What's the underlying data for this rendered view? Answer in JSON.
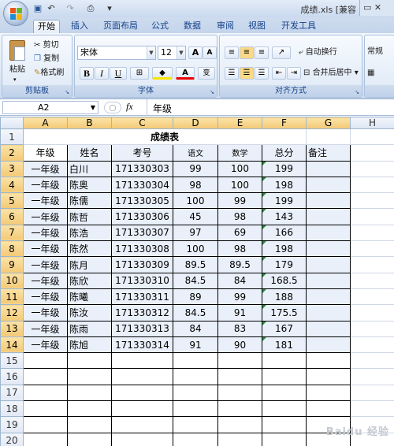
{
  "window": {
    "title": "成绩.xls  [兼容"
  },
  "qat": {
    "undo": "↶",
    "redo": "↷",
    "print_preview": "⎙",
    "customize": "▾"
  },
  "tabs": [
    "开始",
    "插入",
    "页面布局",
    "公式",
    "数据",
    "审阅",
    "视图",
    "开发工具"
  ],
  "ribbon": {
    "clipboard": {
      "label": "剪贴板",
      "paste": "粘贴",
      "cut": "剪切",
      "copy": "复制",
      "format_painter": "格式刷"
    },
    "font": {
      "label": "字体",
      "font_name": "宋体",
      "font_size": "12",
      "grow": "A",
      "shrink": "A",
      "bold": "B",
      "italic": "I",
      "underline": "U",
      "color_text": "A",
      "phonetic": "变"
    },
    "alignment": {
      "label": "对齐方式",
      "wrap_text": "自动换行",
      "merge_center": "合并后居中"
    },
    "number": {
      "format": "常规"
    }
  },
  "formula_bar": {
    "name_box": "A2",
    "fx": "fx",
    "content": "年级"
  },
  "columns": [
    "A",
    "B",
    "C",
    "D",
    "E",
    "F",
    "G",
    "H"
  ],
  "rows": [
    "1",
    "2",
    "3",
    "4",
    "5",
    "6",
    "7",
    "8",
    "9",
    "10",
    "11",
    "12",
    "13",
    "14",
    "15",
    "16",
    "17",
    "18",
    "19",
    "20"
  ],
  "sheet": {
    "title": "成绩表",
    "headers": [
      "年级",
      "姓名",
      "考号",
      "语文",
      "数学",
      "总分",
      "备注"
    ],
    "records": [
      [
        "一年级",
        "白川",
        "171330303",
        "99",
        "100",
        "199",
        ""
      ],
      [
        "一年级",
        "陈奥",
        "171330304",
        "98",
        "100",
        "198",
        ""
      ],
      [
        "一年级",
        "陈儒",
        "171330305",
        "100",
        "99",
        "199",
        ""
      ],
      [
        "一年级",
        "陈哲",
        "171330306",
        "45",
        "98",
        "143",
        ""
      ],
      [
        "一年级",
        "陈浩",
        "171330307",
        "97",
        "69",
        "166",
        ""
      ],
      [
        "一年级",
        "陈然",
        "171330308",
        "100",
        "98",
        "198",
        ""
      ],
      [
        "一年级",
        "陈月",
        "171330309",
        "89.5",
        "89.5",
        "179",
        ""
      ],
      [
        "一年级",
        "陈欣",
        "171330310",
        "84.5",
        "84",
        "168.5",
        ""
      ],
      [
        "一年级",
        "陈曦",
        "171330311",
        "89",
        "99",
        "188",
        ""
      ],
      [
        "一年级",
        "陈汝",
        "171330312",
        "84.5",
        "91",
        "175.5",
        ""
      ],
      [
        "一年级",
        "陈雨",
        "171330313",
        "84",
        "83",
        "167",
        ""
      ],
      [
        "一年级",
        "陈旭",
        "171330314",
        "91",
        "90",
        "181",
        ""
      ]
    ]
  },
  "watermark": "Baidu 经验"
}
